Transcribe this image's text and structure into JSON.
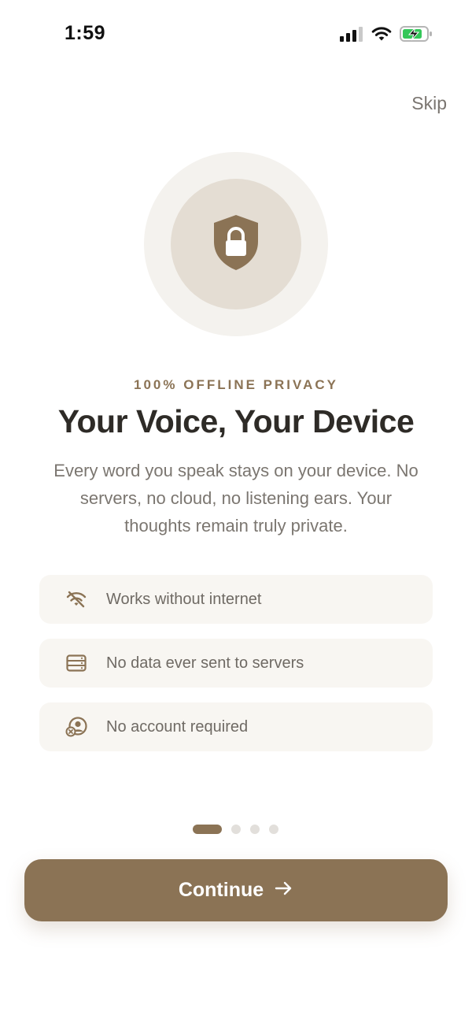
{
  "status_bar": {
    "time": "1:59",
    "signal_icon": "cellular-signal-icon",
    "wifi_icon": "wifi-icon",
    "battery_icon": "battery-charging-icon"
  },
  "header": {
    "skip_label": "Skip"
  },
  "hero": {
    "icon": "shield-lock-icon"
  },
  "content": {
    "eyebrow": "100% OFFLINE PRIVACY",
    "title": "Your Voice, Your Device",
    "description": "Every word you speak stays on your device. No servers, no cloud, no listening ears. Your thoughts remain truly private."
  },
  "features": [
    {
      "icon": "wifi-off-icon",
      "label": "Works without internet"
    },
    {
      "icon": "server-icon",
      "label": "No data ever sent to servers"
    },
    {
      "icon": "user-x-icon",
      "label": "No account required"
    }
  ],
  "pagination": {
    "current": 1,
    "total": 4
  },
  "cta": {
    "label": "Continue",
    "icon": "arrow-right-icon"
  },
  "colors": {
    "accent": "#8b7355",
    "hero_outer": "#f4f2ee",
    "hero_inner": "#e4ddd3",
    "card_bg": "#f8f6f2",
    "title": "#2e2b27",
    "body_text": "#7b7670"
  }
}
